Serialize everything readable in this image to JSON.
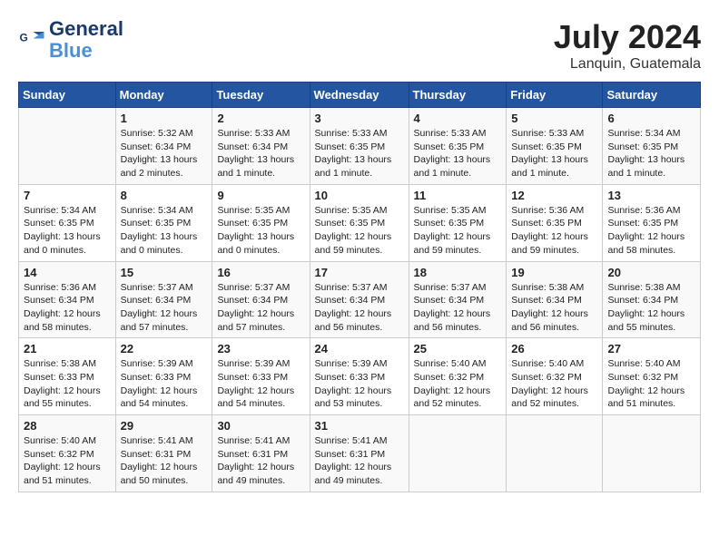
{
  "header": {
    "logo_line1": "General",
    "logo_line2": "Blue",
    "month": "July 2024",
    "location": "Lanquin, Guatemala"
  },
  "columns": [
    "Sunday",
    "Monday",
    "Tuesday",
    "Wednesday",
    "Thursday",
    "Friday",
    "Saturday"
  ],
  "weeks": [
    [
      {
        "day": "",
        "info": ""
      },
      {
        "day": "1",
        "info": "Sunrise: 5:32 AM\nSunset: 6:34 PM\nDaylight: 13 hours\nand 2 minutes."
      },
      {
        "day": "2",
        "info": "Sunrise: 5:33 AM\nSunset: 6:34 PM\nDaylight: 13 hours\nand 1 minute."
      },
      {
        "day": "3",
        "info": "Sunrise: 5:33 AM\nSunset: 6:35 PM\nDaylight: 13 hours\nand 1 minute."
      },
      {
        "day": "4",
        "info": "Sunrise: 5:33 AM\nSunset: 6:35 PM\nDaylight: 13 hours\nand 1 minute."
      },
      {
        "day": "5",
        "info": "Sunrise: 5:33 AM\nSunset: 6:35 PM\nDaylight: 13 hours\nand 1 minute."
      },
      {
        "day": "6",
        "info": "Sunrise: 5:34 AM\nSunset: 6:35 PM\nDaylight: 13 hours\nand 1 minute."
      }
    ],
    [
      {
        "day": "7",
        "info": "Sunrise: 5:34 AM\nSunset: 6:35 PM\nDaylight: 13 hours\nand 0 minutes."
      },
      {
        "day": "8",
        "info": "Sunrise: 5:34 AM\nSunset: 6:35 PM\nDaylight: 13 hours\nand 0 minutes."
      },
      {
        "day": "9",
        "info": "Sunrise: 5:35 AM\nSunset: 6:35 PM\nDaylight: 13 hours\nand 0 minutes."
      },
      {
        "day": "10",
        "info": "Sunrise: 5:35 AM\nSunset: 6:35 PM\nDaylight: 12 hours\nand 59 minutes."
      },
      {
        "day": "11",
        "info": "Sunrise: 5:35 AM\nSunset: 6:35 PM\nDaylight: 12 hours\nand 59 minutes."
      },
      {
        "day": "12",
        "info": "Sunrise: 5:36 AM\nSunset: 6:35 PM\nDaylight: 12 hours\nand 59 minutes."
      },
      {
        "day": "13",
        "info": "Sunrise: 5:36 AM\nSunset: 6:35 PM\nDaylight: 12 hours\nand 58 minutes."
      }
    ],
    [
      {
        "day": "14",
        "info": "Sunrise: 5:36 AM\nSunset: 6:34 PM\nDaylight: 12 hours\nand 58 minutes."
      },
      {
        "day": "15",
        "info": "Sunrise: 5:37 AM\nSunset: 6:34 PM\nDaylight: 12 hours\nand 57 minutes."
      },
      {
        "day": "16",
        "info": "Sunrise: 5:37 AM\nSunset: 6:34 PM\nDaylight: 12 hours\nand 57 minutes."
      },
      {
        "day": "17",
        "info": "Sunrise: 5:37 AM\nSunset: 6:34 PM\nDaylight: 12 hours\nand 56 minutes."
      },
      {
        "day": "18",
        "info": "Sunrise: 5:37 AM\nSunset: 6:34 PM\nDaylight: 12 hours\nand 56 minutes."
      },
      {
        "day": "19",
        "info": "Sunrise: 5:38 AM\nSunset: 6:34 PM\nDaylight: 12 hours\nand 56 minutes."
      },
      {
        "day": "20",
        "info": "Sunrise: 5:38 AM\nSunset: 6:34 PM\nDaylight: 12 hours\nand 55 minutes."
      }
    ],
    [
      {
        "day": "21",
        "info": "Sunrise: 5:38 AM\nSunset: 6:33 PM\nDaylight: 12 hours\nand 55 minutes."
      },
      {
        "day": "22",
        "info": "Sunrise: 5:39 AM\nSunset: 6:33 PM\nDaylight: 12 hours\nand 54 minutes."
      },
      {
        "day": "23",
        "info": "Sunrise: 5:39 AM\nSunset: 6:33 PM\nDaylight: 12 hours\nand 54 minutes."
      },
      {
        "day": "24",
        "info": "Sunrise: 5:39 AM\nSunset: 6:33 PM\nDaylight: 12 hours\nand 53 minutes."
      },
      {
        "day": "25",
        "info": "Sunrise: 5:40 AM\nSunset: 6:32 PM\nDaylight: 12 hours\nand 52 minutes."
      },
      {
        "day": "26",
        "info": "Sunrise: 5:40 AM\nSunset: 6:32 PM\nDaylight: 12 hours\nand 52 minutes."
      },
      {
        "day": "27",
        "info": "Sunrise: 5:40 AM\nSunset: 6:32 PM\nDaylight: 12 hours\nand 51 minutes."
      }
    ],
    [
      {
        "day": "28",
        "info": "Sunrise: 5:40 AM\nSunset: 6:32 PM\nDaylight: 12 hours\nand 51 minutes."
      },
      {
        "day": "29",
        "info": "Sunrise: 5:41 AM\nSunset: 6:31 PM\nDaylight: 12 hours\nand 50 minutes."
      },
      {
        "day": "30",
        "info": "Sunrise: 5:41 AM\nSunset: 6:31 PM\nDaylight: 12 hours\nand 49 minutes."
      },
      {
        "day": "31",
        "info": "Sunrise: 5:41 AM\nSunset: 6:31 PM\nDaylight: 12 hours\nand 49 minutes."
      },
      {
        "day": "",
        "info": ""
      },
      {
        "day": "",
        "info": ""
      },
      {
        "day": "",
        "info": ""
      }
    ]
  ]
}
